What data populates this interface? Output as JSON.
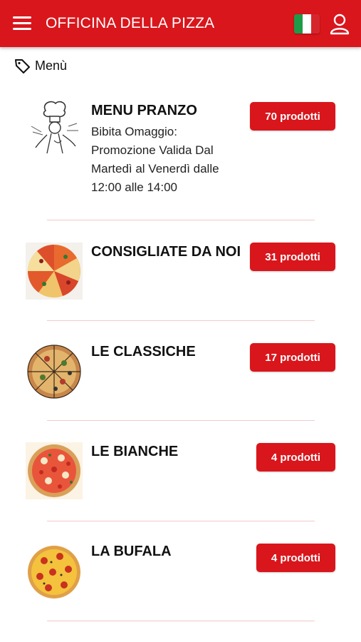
{
  "header": {
    "title": "OFFICINA DELLA PIZZA",
    "menu_icon": "hamburger-menu-icon",
    "language_icon": "italian-flag-icon",
    "user_icon": "user-profile-icon",
    "brand_color": "#d9161c"
  },
  "breadcrumb": {
    "icon": "tag-icon",
    "label": "Menù"
  },
  "categories": [
    {
      "title": "MENU PRANZO",
      "description": "Bibita Omaggio: Promozione Valida Dal Martedì al Venerdì dalle 12:00 alle 14:00",
      "count_label": "70 prodotti",
      "image": "chef-sketch-image"
    },
    {
      "title": "CONSIGLIATE DA NOI",
      "description": "",
      "count_label": "31 prodotti",
      "image": "mixed-pizza-slices-image"
    },
    {
      "title": "LE CLASSICHE",
      "description": "",
      "count_label": "17 prodotti",
      "image": "classic-pizza-image"
    },
    {
      "title": "LE BIANCHE",
      "description": "",
      "count_label": "4 prodotti",
      "image": "pizza-bianca-image"
    },
    {
      "title": "LA BUFALA",
      "description": "",
      "count_label": "4 prodotti",
      "image": "pepperoni-pizza-image"
    }
  ]
}
